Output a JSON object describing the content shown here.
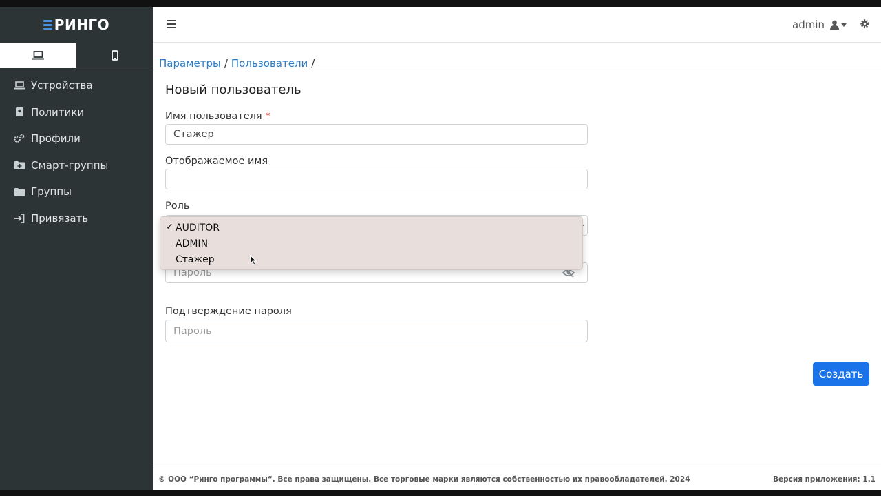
{
  "brand": {
    "name": "РИНГО"
  },
  "device_tabs": [
    {
      "name": "desktop",
      "icon": "laptop-icon",
      "active": true
    },
    {
      "name": "mobile",
      "icon": "mobile-icon",
      "active": false
    }
  ],
  "sidebar": {
    "items": [
      {
        "label": "Устройства",
        "icon": "laptop-icon"
      },
      {
        "label": "Политики",
        "icon": "book-icon"
      },
      {
        "label": "Профили",
        "icon": "gears-icon"
      },
      {
        "label": "Смарт-группы",
        "icon": "folder-plus-icon"
      },
      {
        "label": "Группы",
        "icon": "folder-icon"
      },
      {
        "label": "Привязать",
        "icon": "sign-in-icon"
      }
    ]
  },
  "topbar": {
    "user": "admin"
  },
  "breadcrumb": {
    "items": [
      "Параметры",
      "Пользователи"
    ],
    "separator": "/"
  },
  "form": {
    "title": "Новый пользователь",
    "username_label": "Имя пользователя",
    "required_mark": "*",
    "username_value": "Стажер",
    "display_name_label": "Отображаемое имя",
    "display_name_value": "",
    "role_label": "Роль",
    "password_placeholder": "Пароль",
    "confirm_label": "Подтверждение пароля",
    "confirm_placeholder": "Пароль",
    "create_button": "Создать"
  },
  "role_dropdown": {
    "check": "✓",
    "selected": "AUDITOR",
    "options": [
      "AUDITOR",
      "ADMIN",
      "Стажер"
    ]
  },
  "footer": {
    "copyright": "© ООО “Ринго программы“. Все права защищены. Все торговые марки являются собственностью их правообладателей. 2024",
    "version": "Версия приложения: 1.1"
  },
  "colors": {
    "sidebar_bg": "#2d3436",
    "accent": "#1a73e8",
    "link": "#2d7bc4",
    "brand_mark": "#4a90e2",
    "dropdown_bg": "#e8dedc"
  }
}
